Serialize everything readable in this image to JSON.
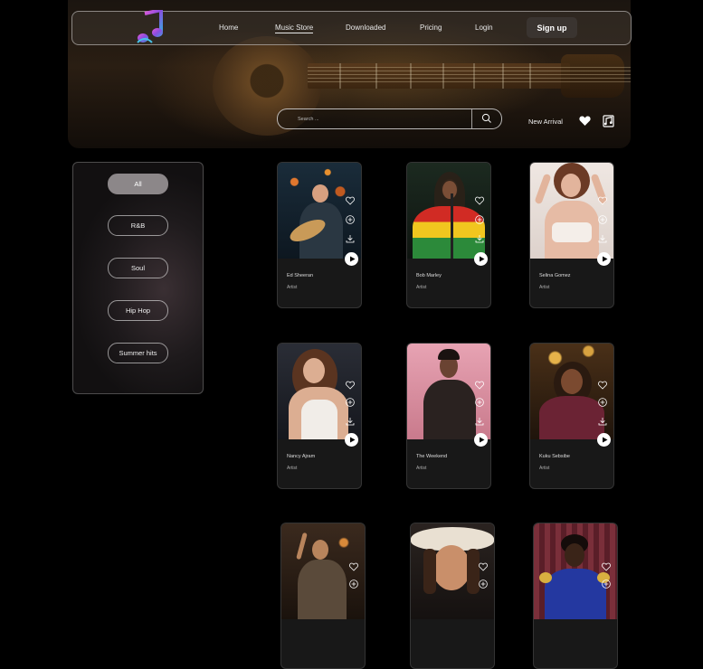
{
  "nav": {
    "links": [
      "Home",
      "Music Store",
      "Downloaded",
      "Pricing",
      "Login"
    ],
    "active": "Music Store",
    "signup_label": "Sign up"
  },
  "search": {
    "placeholder": "Search ..."
  },
  "toolbar": {
    "new_arrival_label": "New Arrival"
  },
  "sidebar": {
    "filters": [
      "All",
      "R&B",
      "Soul",
      "Hip Hop",
      "Summer hits"
    ],
    "active": "All"
  },
  "artists": [
    {
      "name": "Ed Sheeran",
      "role": "Artist"
    },
    {
      "name": "Bob Marley",
      "role": "Artist"
    },
    {
      "name": "Selina Gomez",
      "role": "Artist"
    },
    {
      "name": "Nancy Ajram",
      "role": "Artist"
    },
    {
      "name": "The Weekend",
      "role": "Artist"
    },
    {
      "name": "Kuku Sebsibe",
      "role": "Artist"
    },
    {
      "name": "",
      "role": ""
    },
    {
      "name": "",
      "role": ""
    },
    {
      "name": "",
      "role": ""
    }
  ],
  "icons": {
    "logo": "music-note-logo",
    "search": "search-icon",
    "wishlist": "heart-icon",
    "library": "music-note-icon",
    "card_actions": [
      "heart-icon",
      "plus-circle-icon",
      "download-icon"
    ],
    "play": "play-icon"
  },
  "colors": {
    "background": "#000000",
    "card": "#181818",
    "active_pill": "#8c8789",
    "signup_button": "#3a3430"
  }
}
